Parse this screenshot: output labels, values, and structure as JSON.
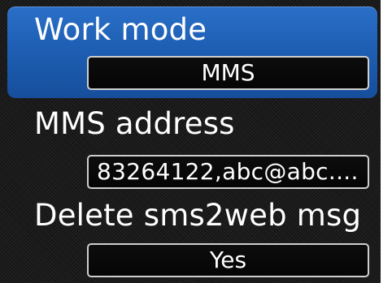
{
  "settings": [
    {
      "label": "Work mode",
      "value": "MMS",
      "selected": true
    },
    {
      "label": "MMS address",
      "value": "83264122,abc@abc...."
    },
    {
      "label": "Delete sms2web msg",
      "value": "Yes"
    }
  ],
  "scrollbar": {
    "position": "bottom"
  },
  "colors": {
    "highlight": "#1e5fb4",
    "scroll_thumb": "#2e74d6",
    "background": "#1a1a1a"
  }
}
